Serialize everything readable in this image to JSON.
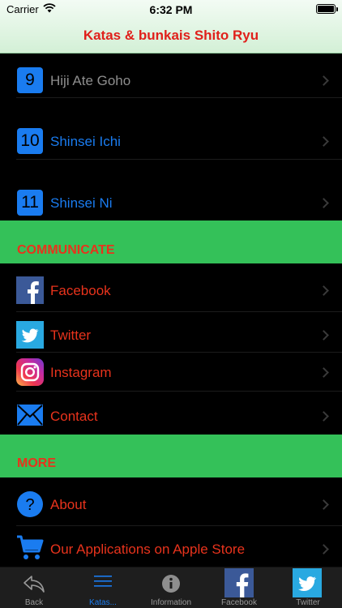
{
  "status": {
    "carrier": "Carrier",
    "time": "6:32 PM"
  },
  "nav": {
    "title": "Katas & bunkais Shito Ryu"
  },
  "katas": [
    {
      "num": "9",
      "label": "Hiji Ate Goho"
    },
    {
      "num": "10",
      "label": "Shinsei Ichi"
    },
    {
      "num": "11",
      "label": "Shinsei Ni"
    }
  ],
  "communicate": {
    "title": "COMMUNICATE",
    "items": [
      {
        "label": "Facebook",
        "icon": "facebook-icon"
      },
      {
        "label": "Twitter",
        "icon": "twitter-icon"
      },
      {
        "label": "Instagram",
        "icon": "instagram-icon"
      },
      {
        "label": "Contact",
        "icon": "mail-icon"
      }
    ]
  },
  "more": {
    "title": "MORE",
    "items": [
      {
        "label": "About",
        "icon": "question-icon"
      },
      {
        "label": "Our Applications on Apple Store",
        "icon": "cart-icon"
      }
    ]
  },
  "tabs": [
    {
      "label": "Back"
    },
    {
      "label": "Katas..."
    },
    {
      "label": "Information"
    },
    {
      "label": "Facebook"
    },
    {
      "label": "Twitter"
    }
  ],
  "colors": {
    "header_text": "#e0201b",
    "section_bg": "#34c159",
    "section_text": "#e8331c",
    "link_blue": "#1a7cf0",
    "link_red": "#e8331c",
    "disabled_gray": "#8e8e8e"
  }
}
